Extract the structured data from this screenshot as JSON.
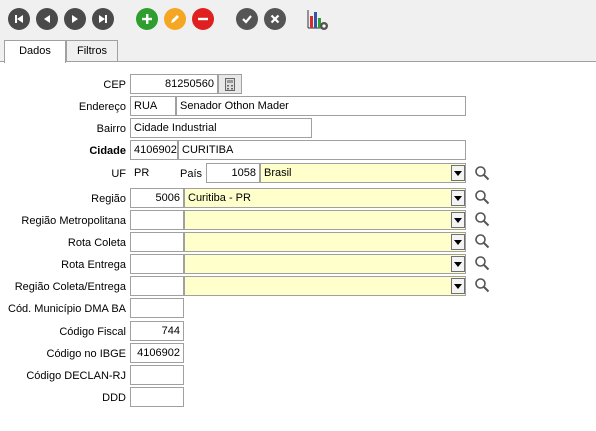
{
  "toolbar": {
    "buttons": [
      {
        "name": "first-record-icon",
        "color": "#4a4a4a"
      },
      {
        "name": "previous-record-icon",
        "color": "#4a4a4a"
      },
      {
        "name": "next-record-icon",
        "color": "#4a4a4a"
      },
      {
        "name": "last-record-icon",
        "color": "#4a4a4a"
      },
      {
        "name": "add-icon",
        "color": "#2e9e2e"
      },
      {
        "name": "edit-icon",
        "color": "#f5a623"
      },
      {
        "name": "delete-icon",
        "color": "#e02020"
      },
      {
        "name": "confirm-icon",
        "color": "#555555"
      },
      {
        "name": "cancel-icon",
        "color": "#555555"
      },
      {
        "name": "report-chart-icon",
        "color": "#3355aa"
      }
    ]
  },
  "tabs": [
    {
      "label": "Dados",
      "active": true
    },
    {
      "label": "Filtros",
      "active": false
    }
  ],
  "form": {
    "cep": {
      "label": "CEP",
      "value": "81250560"
    },
    "endereco": {
      "label": "Endereço",
      "type": "RUA",
      "value": "Senador Othon Mader"
    },
    "bairro": {
      "label": "Bairro",
      "value": "Cidade Industrial"
    },
    "cidade": {
      "label": "Cidade",
      "code": "4106902",
      "name": "CURITIBA"
    },
    "uf": {
      "label": "UF",
      "value": "PR"
    },
    "pais": {
      "label": "País",
      "code": "1058",
      "name": "Brasil"
    },
    "regiao": {
      "label": "Região",
      "code": "5006",
      "name": "Curitiba - PR"
    },
    "regiao_metropolitana": {
      "label": "Região Metropolitana",
      "code": "",
      "name": ""
    },
    "rota_coleta": {
      "label": "Rota Coleta",
      "code": "",
      "name": ""
    },
    "rota_entrega": {
      "label": "Rota Entrega",
      "code": "",
      "name": ""
    },
    "regiao_coleta_entrega": {
      "label": "Região Coleta/Entrega",
      "code": "",
      "name": ""
    },
    "cod_municipio_dma_ba": {
      "label": "Cód. Município DMA BA",
      "value": ""
    },
    "codigo_fiscal": {
      "label": "Código Fiscal",
      "value": "744"
    },
    "codigo_ibge": {
      "label": "Código no IBGE",
      "value": "4106902"
    },
    "codigo_declan_rj": {
      "label": "Código DECLAN-RJ",
      "value": ""
    },
    "ddd": {
      "label": "DDD",
      "value": ""
    }
  }
}
